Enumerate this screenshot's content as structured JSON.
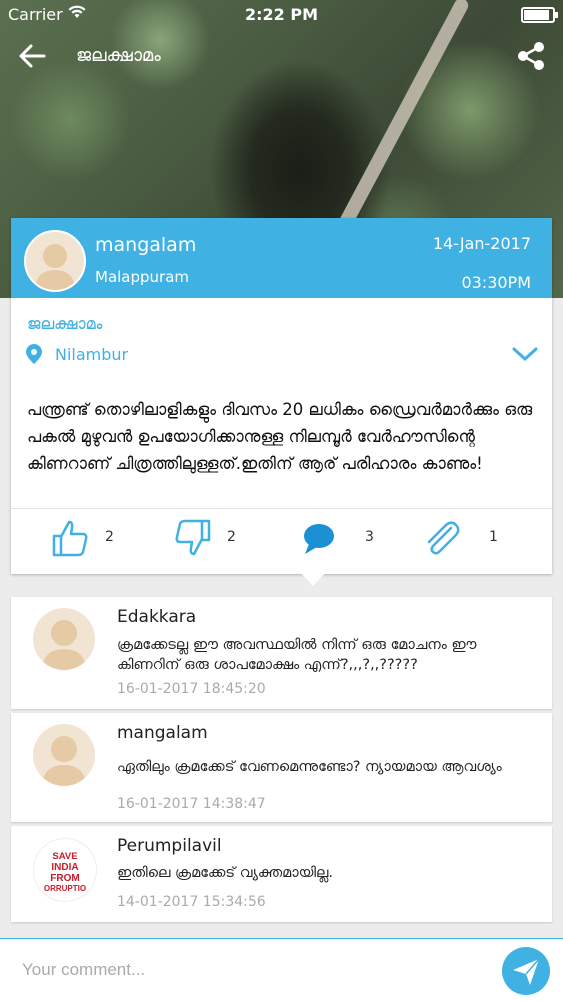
{
  "status": {
    "carrier": "Carrier",
    "time": "2:22 PM"
  },
  "topbar": {
    "title": "ജലക്ഷാമം"
  },
  "post": {
    "author": "mangalam",
    "place": "Malappuram",
    "date": "14-Jan-2017",
    "time": "03:30PM",
    "category": "ജലക്ഷാമം",
    "location": "Nilambur",
    "text": "പന്ത്രണ്ട് തൊഴിലാളികളും ദിവസം 20 ലധികം ഡ്രൈവർമാർക്കും ഒരു പകൽ മുഴുവൻ ഉപയോഗിക്കാനുള്ള നിലമ്പൂർ വേർഹൗസിന്റെ കിണറാണ് ചിത്രത്തിലുള്ളത്.ഇതിന് ആര് പരിഹാരം കാണും!",
    "likes": "2",
    "dislikes": "2",
    "comments": "3",
    "attachments": "1"
  },
  "comments": [
    {
      "name": "Edakkara",
      "text": "ക്രമക്കേടല്ല ഈ അവസ്ഥയിൽ നിന്ന് ഒരു മോചനം ഈ കിണറിന് ഒരു ശാപമോക്ഷം എന്ന്?,,,?,,?????",
      "date": "16-01-2017 18:45:20"
    },
    {
      "name": "mangalam",
      "text": "ഏതിലും ക്രമക്കേട് വേണമെന്നുണ്ടോ? ന്യായമായ ആവശ്യം",
      "date": "16-01-2017 14:38:47"
    },
    {
      "name": "Perumpilavil",
      "text": "ഇതിലെ ക്രമക്കേട് വ്യക്തമായില്ല.",
      "date": "14-01-2017 15:34:56",
      "avatar_text": [
        "SAVE",
        "INDIA",
        "FROM",
        "CORRUPTION"
      ]
    }
  ],
  "composer": {
    "placeholder": "Your comment..."
  },
  "colors": {
    "accent": "#3fb1e2"
  }
}
